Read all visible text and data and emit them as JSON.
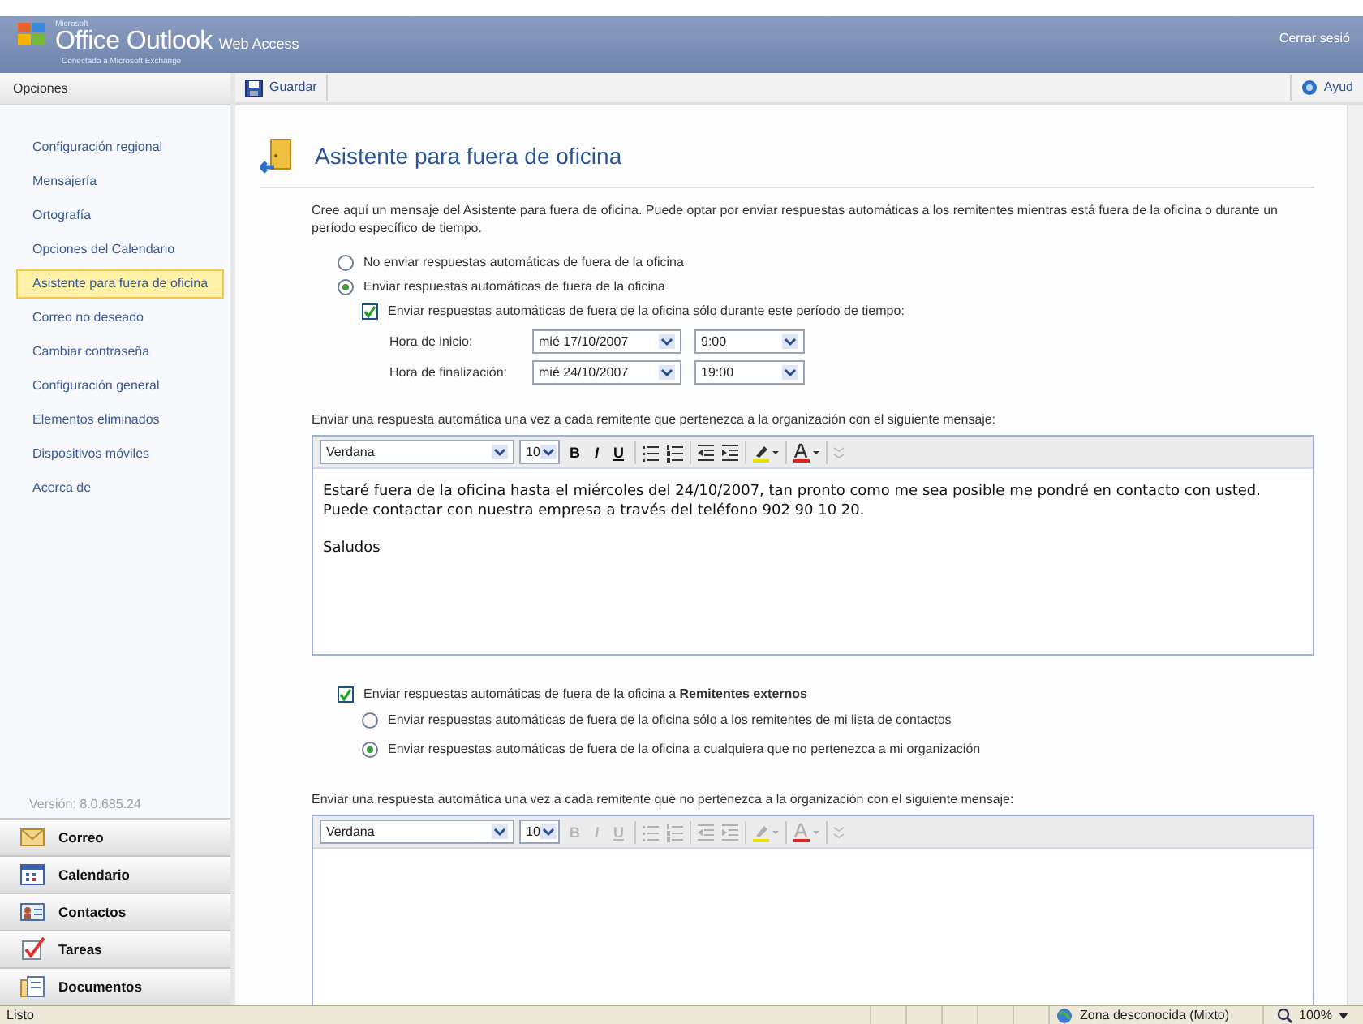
{
  "header": {
    "brand_small": "Microsoft",
    "brand_title": "Office Outlook",
    "brand_suffix": "Web Access",
    "subtitle": "Conectado a Microsoft Exchange",
    "logout": "Cerrar sesió"
  },
  "sidebar": {
    "title": "Opciones",
    "items": [
      {
        "label": "Configuración regional",
        "selected": false
      },
      {
        "label": "Mensajería",
        "selected": false
      },
      {
        "label": "Ortografía",
        "selected": false
      },
      {
        "label": "Opciones del Calendario",
        "selected": false
      },
      {
        "label": "Asistente para fuera de oficina",
        "selected": true
      },
      {
        "label": "Correo no deseado",
        "selected": false
      },
      {
        "label": "Cambiar contraseña",
        "selected": false
      },
      {
        "label": "Configuración general",
        "selected": false
      },
      {
        "label": "Elementos eliminados",
        "selected": false
      },
      {
        "label": "Dispositivos móviles",
        "selected": false
      },
      {
        "label": "Acerca de",
        "selected": false
      }
    ],
    "version": "Versión: 8.0.685.24",
    "nav": [
      {
        "label": "Correo",
        "kind": "mail"
      },
      {
        "label": "Calendario",
        "kind": "calendar"
      },
      {
        "label": "Contactos",
        "kind": "contacts"
      },
      {
        "label": "Tareas",
        "kind": "tasks"
      },
      {
        "label": "Documentos",
        "kind": "documents"
      }
    ]
  },
  "toolbar": {
    "save": "Guardar",
    "help": "Ayud"
  },
  "page": {
    "title": "Asistente para fuera de oficina",
    "intro": "Cree aquí un mensaje del Asistente para fuera de oficina. Puede optar por enviar respuestas automáticas a los remitentes mientras está fuera de la oficina o durante un período específico de tiempo.",
    "mode_options": [
      {
        "label": "No enviar respuestas automáticas de fuera de la oficina",
        "selected": false
      },
      {
        "label": "Enviar respuestas automáticas de fuera de la oficina",
        "selected": true
      }
    ],
    "period": {
      "label": "Enviar respuestas automáticas de fuera de la oficina sólo durante este período de tiempo:",
      "checked": true
    },
    "dates": [
      {
        "label": "Hora de inicio:",
        "date": "mié 17/10/2007",
        "time": "9:00"
      },
      {
        "label": "Hora de finalización:",
        "date": "mié 24/10/2007",
        "time": "19:00"
      }
    ],
    "internal": {
      "label": "Enviar una respuesta automática una vez a cada remitente que pertenezca a la organización con el siguiente mensaje:",
      "editor": {
        "font": "Verdana",
        "size": "10",
        "disabled": false,
        "bold": "B",
        "italic": "I",
        "underline": "U",
        "paragraphs": [
          "Estaré fuera de la oficina hasta el miércoles del 24/10/2007, tan pronto como me sea posible me pondré en contacto con usted. Puede contactar con nuestra empresa a través del teléfono 902 90 10 20.",
          "Saludos"
        ]
      }
    },
    "external": {
      "label": "Enviar respuestas automáticas de fuera de la oficina a **Remitentes externos**",
      "checked": true,
      "options": [
        {
          "label": "Enviar respuestas automáticas de fuera de la oficina sólo a los remitentes de mi lista de contactos",
          "selected": false
        },
        {
          "label": "Enviar respuestas automáticas de fuera de la oficina a cualquiera que no pertenezca a mi organización",
          "selected": true
        }
      ],
      "message_label": "Enviar una respuesta automática una vez a cada remitente que no pertenezca a la organización con el siguiente mensaje:",
      "editor": {
        "font": "Verdana",
        "size": "10",
        "disabled": true,
        "bold": "B",
        "italic": "I",
        "underline": "U"
      }
    }
  },
  "status_bar": {
    "text": "Listo",
    "zone": "Zona desconocida (Mixto)",
    "zoom": "100%"
  }
}
